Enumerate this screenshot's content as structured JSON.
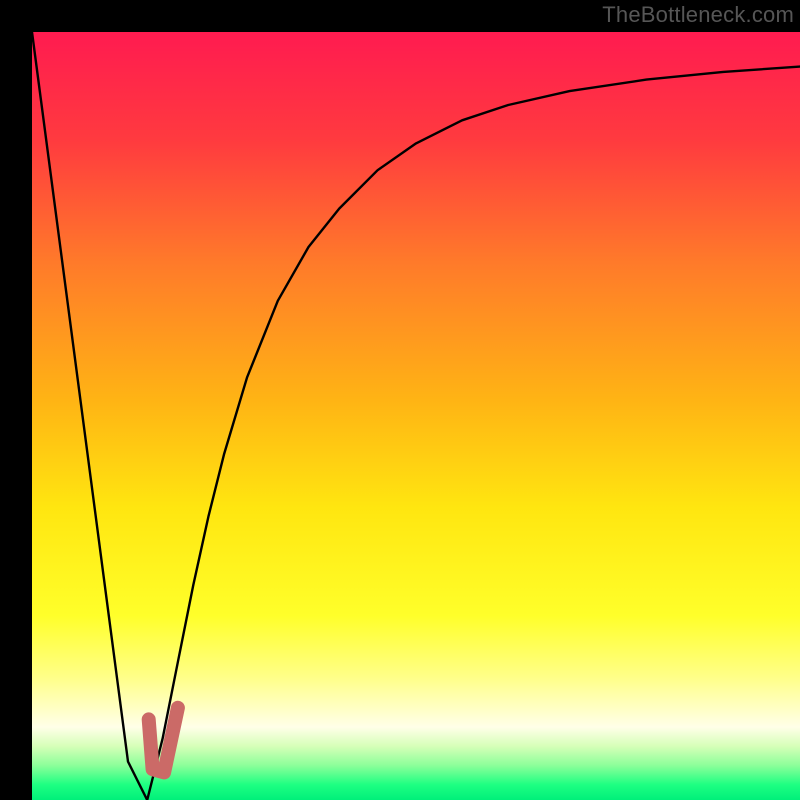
{
  "watermark": "TheBottleneck.com",
  "colors": {
    "frame": "#000000",
    "gradient_stops": [
      {
        "offset": 0.0,
        "color": "#ff1b50"
      },
      {
        "offset": 0.14,
        "color": "#ff3a3f"
      },
      {
        "offset": 0.3,
        "color": "#ff7a2a"
      },
      {
        "offset": 0.48,
        "color": "#ffb414"
      },
      {
        "offset": 0.62,
        "color": "#ffe610"
      },
      {
        "offset": 0.76,
        "color": "#ffff2a"
      },
      {
        "offset": 0.84,
        "color": "#ffff88"
      },
      {
        "offset": 0.905,
        "color": "#ffffe8"
      },
      {
        "offset": 0.93,
        "color": "#d6ffb8"
      },
      {
        "offset": 0.955,
        "color": "#8cff9a"
      },
      {
        "offset": 0.98,
        "color": "#1eff82"
      },
      {
        "offset": 1.0,
        "color": "#00f07a"
      }
    ],
    "curve": "#000000",
    "marker": "#cb6a67"
  },
  "chart_data": {
    "type": "line",
    "title": "",
    "xlabel": "",
    "ylabel": "",
    "x_range": [
      0,
      100
    ],
    "y_range": [
      0,
      100
    ],
    "series": [
      {
        "name": "bottleneck-curve",
        "x": [
          0,
          5,
          10,
          12.5,
          15,
          17,
          19,
          21,
          23,
          25,
          28,
          32,
          36,
          40,
          45,
          50,
          56,
          62,
          70,
          80,
          90,
          100
        ],
        "values": [
          100,
          62,
          24,
          5,
          0,
          8,
          18,
          28,
          37,
          45,
          55,
          65,
          72,
          77,
          82,
          85.5,
          88.5,
          90.5,
          92.3,
          93.8,
          94.8,
          95.5
        ]
      }
    ],
    "marker": {
      "name": "current-point",
      "path_xy": [
        [
          15.2,
          10.5
        ],
        [
          15.7,
          4.0
        ],
        [
          17.2,
          3.6
        ],
        [
          19.0,
          12.0
        ]
      ]
    }
  }
}
